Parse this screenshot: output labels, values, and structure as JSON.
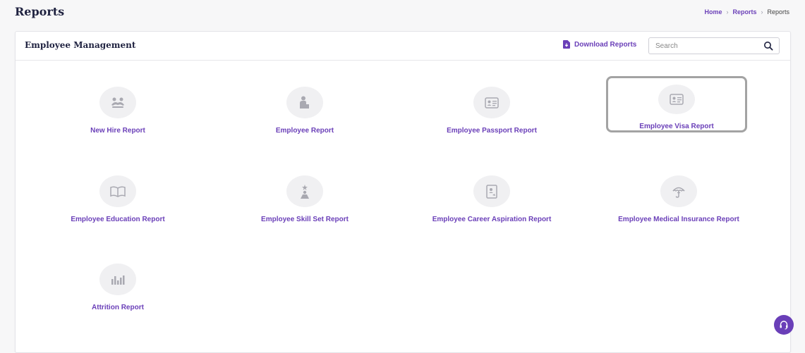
{
  "page": {
    "title": "Reports"
  },
  "breadcrumb": {
    "items": [
      {
        "label": "Home"
      },
      {
        "label": "Reports"
      }
    ],
    "current": "Reports"
  },
  "card": {
    "title": "Employee Management",
    "download_label": "Download Reports",
    "search": {
      "placeholder": "Search",
      "value": ""
    }
  },
  "reports": [
    {
      "label": "New Hire Report",
      "icon": "new-hire-icon"
    },
    {
      "label": "Employee Report",
      "icon": "employee-icon"
    },
    {
      "label": "Employee Passport Report",
      "icon": "id-card-icon"
    },
    {
      "label": "Employee Visa Report",
      "icon": "id-card-icon",
      "selected": true
    },
    {
      "label": "Employee Education Report",
      "icon": "book-icon"
    },
    {
      "label": "Employee Skill Set Report",
      "icon": "skill-icon"
    },
    {
      "label": "Employee Career Aspiration Report",
      "icon": "career-icon"
    },
    {
      "label": "Employee Medical Insurance Report",
      "icon": "umbrella-icon"
    },
    {
      "label": "Attrition Report",
      "icon": "bar-chart-icon"
    }
  ],
  "colors": {
    "accent": "#6a3fb8",
    "icon_gray": "#9b9ba3",
    "circle_bg": "#f0f0f2",
    "selected_border": "#a3a3a3"
  }
}
